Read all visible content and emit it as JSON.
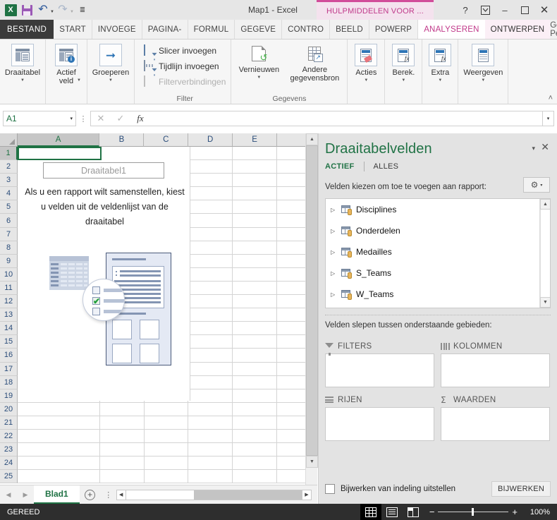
{
  "window": {
    "title": "Map1 - Excel",
    "contextual_tab_title": "HULPMIDDELEN VOOR ...",
    "help_icon": "?",
    "ribbon_display_icon": "ribbon-display-options-icon",
    "minimize_icon": "–",
    "restore_icon": "❐",
    "close_icon": "✕"
  },
  "quick_access": {
    "app_logo": "excel-logo-icon",
    "save": "save-icon",
    "undo": "undo-icon",
    "redo": "redo-icon",
    "customize": "customize-qat-icon"
  },
  "tabs": {
    "file": "BESTAND",
    "items": [
      "START",
      "INVOEGE",
      "PAGINA-",
      "FORMUL",
      "GEGEVE",
      "CONTRO",
      "BEELD",
      "POWERP"
    ],
    "contextual": [
      {
        "label": "ANALYSEREN",
        "active": true
      },
      {
        "label": "ONTWERPEN",
        "active": false
      }
    ],
    "user": "Gerko Pet..",
    "user_caret": "▾"
  },
  "ribbon": {
    "groups": [
      {
        "name": "pivottable-group",
        "label": "",
        "buttons": [
          {
            "name": "draaitabel-button",
            "label": "Draaitabel",
            "icon": "pivottable-icon",
            "has_dropdown": true
          },
          {
            "name": "actief-veld-button",
            "label": "Actief\nveld",
            "icon": "active-field-icon",
            "has_dropdown": true
          },
          {
            "name": "groeperen-button",
            "label": "Groeperen",
            "icon": "group-arrow-icon",
            "has_dropdown": true
          }
        ]
      },
      {
        "name": "filter-group",
        "label": "Filter",
        "small_buttons": [
          {
            "name": "slicer-invoegen-button",
            "label": "Slicer invoegen",
            "icon": "slicer-icon",
            "disabled": false
          },
          {
            "name": "tijdlijn-invoegen-button",
            "label": "Tijdlijn invoegen",
            "icon": "timeline-icon",
            "disabled": false
          },
          {
            "name": "filterverbindingen-button",
            "label": "Filterverbindingen",
            "icon": "filter-connections-icon",
            "disabled": true
          }
        ]
      },
      {
        "name": "gegevens-group",
        "label": "Gegevens",
        "buttons": [
          {
            "name": "vernieuwen-button",
            "label": "Vernieuwen",
            "icon": "refresh-icon",
            "has_dropdown": true
          },
          {
            "name": "andere-gegevensbron-button",
            "label": "Andere\ngegevensbron",
            "icon": "change-data-source-icon",
            "has_dropdown": true
          }
        ]
      },
      {
        "name": "acties-group",
        "label": "",
        "buttons": [
          {
            "name": "acties-button",
            "label": "Acties",
            "icon": "actions-icon",
            "has_dropdown": true
          }
        ]
      },
      {
        "name": "berekeningen-group",
        "label": "",
        "buttons": [
          {
            "name": "berekeningen-button",
            "label": "Berek.",
            "icon": "calculations-icon",
            "has_dropdown": true
          }
        ]
      },
      {
        "name": "extra-group",
        "label": "",
        "buttons": [
          {
            "name": "extra-button",
            "label": "Extra",
            "icon": "tools-icon",
            "has_dropdown": true
          }
        ]
      },
      {
        "name": "weergeven-group",
        "label": "",
        "buttons": [
          {
            "name": "weergeven-button",
            "label": "Weergeven",
            "icon": "show-icon",
            "has_dropdown": true
          }
        ]
      }
    ],
    "collapse_icon": "˄"
  },
  "formula_bar": {
    "name_box_value": "A1",
    "name_box_caret": "▾",
    "cancel_icon": "✕",
    "enter_icon": "✓",
    "fx_icon": "fx",
    "value": "",
    "expand_icon": "▾"
  },
  "grid": {
    "columns": [
      "A",
      "B",
      "C",
      "D",
      "E",
      ""
    ],
    "selected_column": "A",
    "rows": [
      1,
      2,
      3,
      4,
      5,
      6,
      7,
      8,
      9,
      10,
      11,
      12,
      13,
      14,
      15,
      16,
      17,
      18,
      19,
      20,
      21,
      22,
      23,
      24,
      25
    ],
    "selected_row": 1,
    "active_cell": "A1"
  },
  "pivot_placeholder": {
    "name": "Draaitabel1",
    "message": "Als u een rapport wilt samenstellen, kiest u velden uit de veldenlijst van de draaitabel",
    "illustration": "pivottable-illustration"
  },
  "sheet_bar": {
    "prev_icon": "◀",
    "next_icon": "▶",
    "tabs": [
      "Blad1"
    ],
    "active_tab": "Blad1",
    "add_sheet_icon": "+",
    "tab_menu_icon": "⋮"
  },
  "status_bar": {
    "status": "GEREED",
    "views": [
      {
        "name": "normal-view-button",
        "icon": "grid-view-icon",
        "active": true
      },
      {
        "name": "page-layout-view-button",
        "icon": "page-layout-icon",
        "active": false
      },
      {
        "name": "page-break-view-button",
        "icon": "page-break-icon",
        "active": false
      }
    ],
    "zoom_out": "−",
    "zoom_in": "+",
    "zoom_value": "100%"
  },
  "pivot_pane": {
    "title": "Draaitabelvelden",
    "minimize_icon": "▾",
    "close_icon": "✕",
    "subtabs": [
      {
        "label": "ACTIEF",
        "active": true
      },
      {
        "label": "ALLES",
        "active": false
      }
    ],
    "prompt": "Velden kiezen om toe te voegen aan rapport:",
    "tools_icon": "gear-icon",
    "tools_caret": "▾",
    "fields": [
      {
        "label": "Disciplines",
        "expand_icon": "▷",
        "icon": "table-source-icon"
      },
      {
        "label": "Onderdelen",
        "expand_icon": "▷",
        "icon": "table-source-icon"
      },
      {
        "label": "Medailles",
        "expand_icon": "▷",
        "icon": "table-source-icon"
      },
      {
        "label": "S_Teams",
        "expand_icon": "▷",
        "icon": "table-source-icon"
      },
      {
        "label": "W_Teams",
        "expand_icon": "▷",
        "icon": "table-source-icon"
      }
    ],
    "scroll_up_icon": "▲",
    "scroll_down_icon": "▼",
    "drag_prompt": "Velden slepen tussen onderstaande gebieden:",
    "zones": [
      {
        "name": "filters-zone",
        "label": "FILTERS",
        "icon": "funnel-icon",
        "items": []
      },
      {
        "name": "kolommen-zone",
        "label": "KOLOMMEN",
        "icon": "columns-icon",
        "items": []
      },
      {
        "name": "rijen-zone",
        "label": "RIJEN",
        "icon": "rows-icon",
        "items": []
      },
      {
        "name": "waarden-zone",
        "label": "WAARDEN",
        "icon": "sigma-icon",
        "items": []
      }
    ],
    "defer_label": "Bijwerken van indeling uitstellen",
    "defer_checked": false,
    "update_button": "BIJWERKEN"
  },
  "colors": {
    "excel_green": "#217346",
    "contextual_pink": "#c0398a",
    "contextual_pink_bar": "#d14d9a",
    "status_bar": "#2e2e2e",
    "pane_bg": "#e3e3e3"
  }
}
